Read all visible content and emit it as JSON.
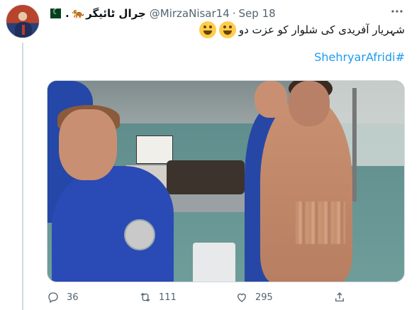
{
  "author": {
    "display_name": "جرال ٹائیگر",
    "handle": "@MirzaNisar14",
    "date": "Sep 18",
    "separator": "·"
  },
  "tweet": {
    "text": "شہریار آفریدی کی شلوار کو عزت دو",
    "hashtag": "ShehryarAfridi#"
  },
  "icons": {
    "more": "more-icon",
    "reply": "reply-icon",
    "retweet": "retweet-icon",
    "like": "heart-icon",
    "share": "share-icon",
    "emoji": "laughing-crying-emoji-icon",
    "flag": "pakistan-flag-icon",
    "tiger": "tiger-emoji-icon"
  },
  "stats": {
    "replies": "36",
    "retweets": "111",
    "likes": "295"
  },
  "colors": {
    "link": "#1d9bf0",
    "secondary_text": "#536471",
    "primary_text": "#0f1419"
  }
}
